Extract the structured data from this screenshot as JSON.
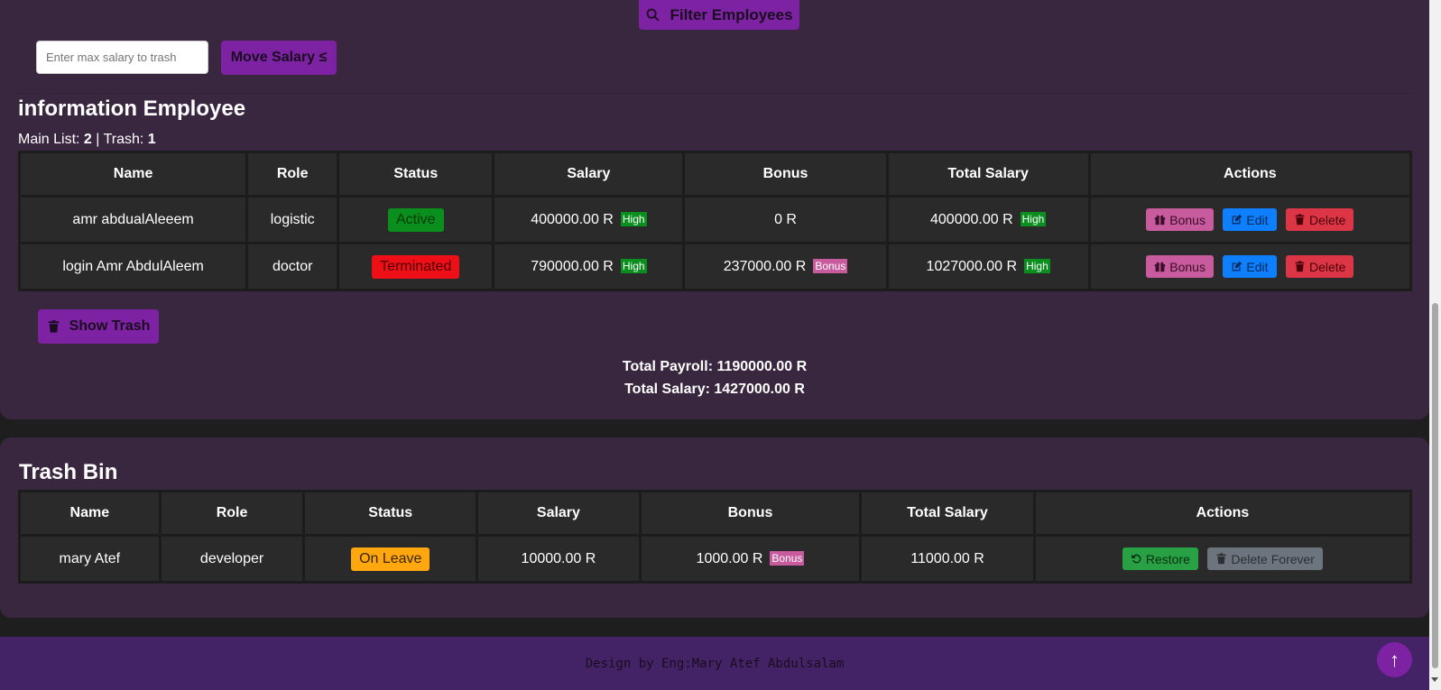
{
  "filter": {
    "label": "Filter Employees"
  },
  "salary_trash": {
    "placeholder": "Enter max salary to trash",
    "button_label": "Move Salary ≤"
  },
  "main": {
    "title": "information Employee",
    "counts_label_main": "Main List:",
    "main_count": "2",
    "counts_sep": "| Trash:",
    "trash_count": "1",
    "headers": [
      "Name",
      "Role",
      "Status",
      "Salary",
      "Bonus",
      "Total Salary",
      "Actions"
    ],
    "rows": [
      {
        "name": "amr abdualAleeem",
        "role": "logistic",
        "status": "Active",
        "salary": "400000.00 R",
        "salary_tag": "High",
        "bonus": "0 R",
        "bonus_tag": "",
        "total": "400000.00 R",
        "total_tag": "High"
      },
      {
        "name": "login Amr AbdulAleem",
        "role": "doctor",
        "status": "Terminated",
        "salary": "790000.00 R",
        "salary_tag": "High",
        "bonus": "237000.00 R",
        "bonus_tag": "Bonus",
        "total": "1027000.00 R",
        "total_tag": "High"
      }
    ],
    "actions": {
      "bonus": "Bonus",
      "edit": "Edit",
      "delete": "Delete"
    },
    "show_trash": "Show Trash",
    "total_payroll": "Total Payroll: 1190000.00 R",
    "total_salary": "Total Salary: 1427000.00 R"
  },
  "trash": {
    "title": "Trash Bin",
    "headers": [
      "Name",
      "Role",
      "Status",
      "Salary",
      "Bonus",
      "Total Salary",
      "Actions"
    ],
    "rows": [
      {
        "name": "mary Atef",
        "role": "developer",
        "status": "On Leave",
        "salary": "10000.00 R",
        "bonus": "1000.00 R",
        "bonus_tag": "Bonus",
        "total": "11000.00 R"
      }
    ],
    "actions": {
      "restore": "Restore",
      "forever": "Delete Forever"
    }
  },
  "footer": {
    "text": "Design by Eng:Mary Atef Abdulsalam"
  },
  "scroll_top": {
    "label": "↑"
  },
  "colors": {
    "panel": "#39273f",
    "purple": "#7c22a3",
    "footer": "#432266"
  }
}
